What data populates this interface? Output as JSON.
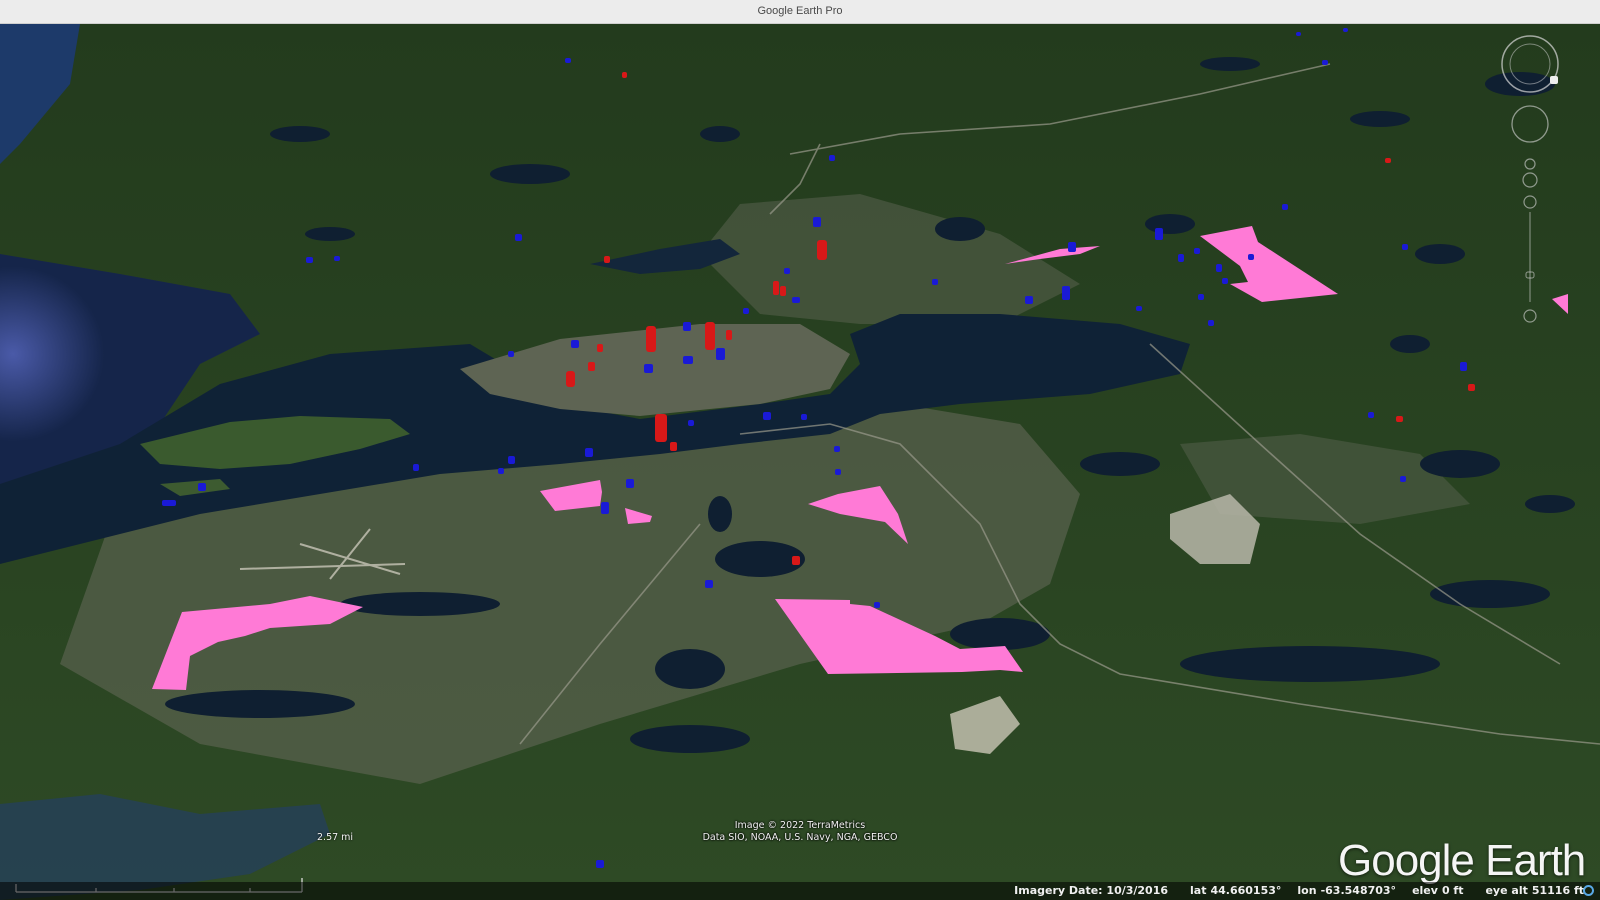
{
  "window": {
    "title": "Google Earth Pro"
  },
  "attribution": {
    "line1": "Image © 2022 TerraMetrics",
    "line2": "Data SIO, NOAA, U.S. Navy, NGA, GEBCO"
  },
  "logo": {
    "text": "Google Earth"
  },
  "scale": {
    "label": "2.57 mi"
  },
  "status": {
    "imagery_date": "Imagery Date: 10/3/2016",
    "lat_label": "lat",
    "lat_value": "44.660153°",
    "lon_label": "lon",
    "lon_value": "-63.548703°",
    "elev_label": "elev",
    "elev_value": "0 ft",
    "eye_alt_label": "eye alt",
    "eye_alt_value": "51116 ft"
  },
  "colors": {
    "polygon_fill": "#ff7ad6",
    "marker_red": "#d81818",
    "marker_blue": "#1a1ad6",
    "water": "#0f2236",
    "land": "#2c4a26"
  },
  "icons": {
    "compass": "compass-ring-icon",
    "look": "look-joystick-icon",
    "street_view": "pegman-icon",
    "zoom": "zoom-slider-icon",
    "status": "loading-ring-icon"
  }
}
